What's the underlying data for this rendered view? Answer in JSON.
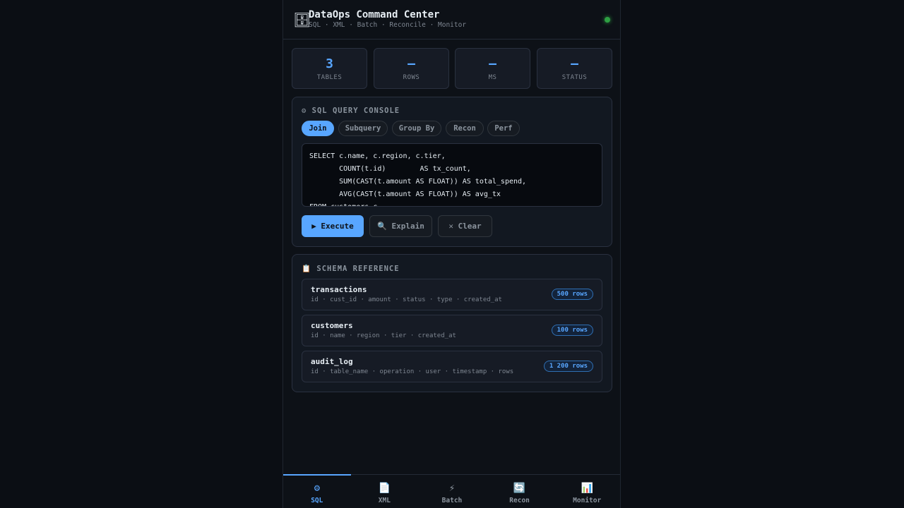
{
  "header": {
    "logo_icon": "🗄",
    "title": "DataOps Command Center",
    "subtitle": "SQL · XML · Batch · Reconcile · Monitor",
    "status_color": "#2ea043"
  },
  "stats": [
    {
      "value": "3",
      "label": "TABLES"
    },
    {
      "value": "—",
      "label": "ROWS"
    },
    {
      "value": "—",
      "label": "MS"
    },
    {
      "value": "—",
      "label": "STATUS"
    }
  ],
  "console": {
    "icon": "⚙",
    "title": "SQL QUERY CONSOLE",
    "tabs": [
      "Join",
      "Subquery",
      "Group By",
      "Recon",
      "Perf"
    ],
    "active_tab": "Join",
    "query": "SELECT c.name, c.region, c.tier,\n       COUNT(t.id)        AS tx_count,\n       SUM(CAST(t.amount AS FLOAT)) AS total_spend,\n       AVG(CAST(t.amount AS FLOAT)) AS avg_tx\nFROM customers c",
    "buttons": {
      "execute": "▶ Execute",
      "explain": "🔍 Explain",
      "clear": "✕ Clear"
    }
  },
  "schema": {
    "icon": "📋",
    "title": "SCHEMA REFERENCE",
    "tables": [
      {
        "name": "transactions",
        "columns": "id · cust_id · amount · status · type · created_at",
        "rows": "500 rows"
      },
      {
        "name": "customers",
        "columns": "id · name · region · tier · created_at",
        "rows": "100 rows"
      },
      {
        "name": "audit_log",
        "columns": "id · table_name · operation · user · timestamp · rows",
        "rows": "1 200 rows"
      }
    ]
  },
  "nav": [
    {
      "icon": "⚙",
      "label": "SQL",
      "active": true
    },
    {
      "icon": "📄",
      "label": "XML",
      "active": false
    },
    {
      "icon": "⚡",
      "label": "Batch",
      "active": false
    },
    {
      "icon": "🔄",
      "label": "Recon",
      "active": false
    },
    {
      "icon": "📊",
      "label": "Monitor",
      "active": false
    }
  ],
  "accent_color": "#58a6ff"
}
